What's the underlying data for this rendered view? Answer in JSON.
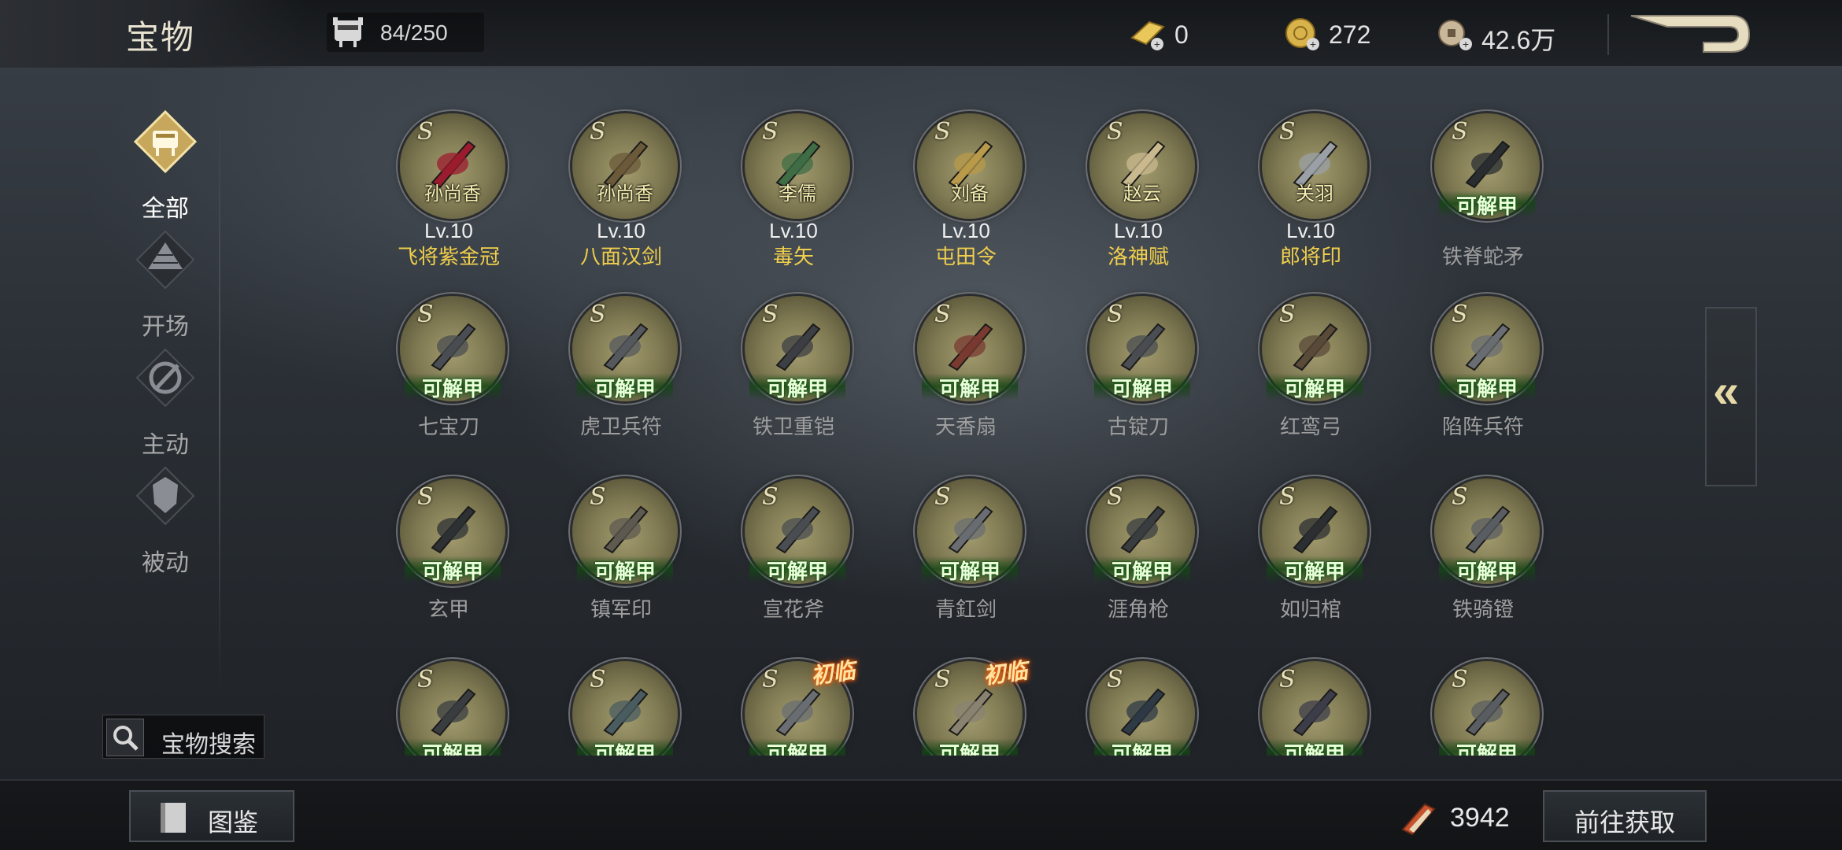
{
  "header": {
    "title": "宝物",
    "capacity": "84/250",
    "resources": [
      {
        "name": "gold-bar",
        "value": "0"
      },
      {
        "name": "gold-coin",
        "value": "272"
      },
      {
        "name": "copper-coin",
        "value": "42.6万"
      }
    ]
  },
  "nav": {
    "items": [
      {
        "label": "全部",
        "active": true,
        "icon": "ding-icon"
      },
      {
        "label": "开场",
        "active": false,
        "icon": "pyramid-icon"
      },
      {
        "label": "主动",
        "active": false,
        "icon": "slash-icon"
      },
      {
        "label": "被动",
        "active": false,
        "icon": "armor-icon"
      }
    ],
    "search_label": "宝物搜索"
  },
  "grade": "S",
  "unlock_label": "可解甲",
  "new_tag": "初临",
  "level_prefix": "Lv.",
  "treasures": [
    {
      "name": "飞将紫金冠",
      "hero": "孙尚香",
      "level": "10",
      "owned": true,
      "color": "#9b1c2e"
    },
    {
      "name": "八面汉剑",
      "hero": "孙尚香",
      "level": "10",
      "owned": true,
      "color": "#6b5a3a"
    },
    {
      "name": "毒矢",
      "hero": "李儒",
      "level": "10",
      "owned": true,
      "color": "#3f6e45"
    },
    {
      "name": "屯田令",
      "hero": "刘备",
      "level": "10",
      "owned": true,
      "color": "#b89a4a"
    },
    {
      "name": "洛神赋",
      "hero": "赵云",
      "level": "10",
      "owned": true,
      "color": "#c9b98e"
    },
    {
      "name": "郎将印",
      "hero": "关羽",
      "level": "10",
      "owned": true,
      "color": "#9aa0a6"
    },
    {
      "name": "铁脊蛇矛",
      "owned": false,
      "color": "#2a2d30"
    },
    {
      "name": "七宝刀",
      "owned": false,
      "color": "#4a4e52"
    },
    {
      "name": "虎卫兵符",
      "owned": false,
      "color": "#55595d"
    },
    {
      "name": "铁卫重铠",
      "owned": false,
      "color": "#3c3f43"
    },
    {
      "name": "天香扇",
      "owned": false,
      "color": "#7a3a30"
    },
    {
      "name": "古锭刀",
      "owned": false,
      "color": "#4a4e52"
    },
    {
      "name": "红鸾弓",
      "owned": false,
      "color": "#5a4a38"
    },
    {
      "name": "陷阵兵符",
      "owned": false,
      "color": "#6a6e72"
    },
    {
      "name": "玄甲",
      "owned": false,
      "color": "#2e3134"
    },
    {
      "name": "镇军印",
      "owned": false,
      "color": "#5e5a50"
    },
    {
      "name": "宣花斧",
      "owned": false,
      "color": "#4a4e52"
    },
    {
      "name": "青釭剑",
      "owned": false,
      "color": "#6a6e72"
    },
    {
      "name": "涯角枪",
      "owned": false,
      "color": "#3a3d40"
    },
    {
      "name": "如归棺",
      "owned": false,
      "color": "#2c2f32"
    },
    {
      "name": "铁骑镫",
      "owned": false,
      "color": "#5a5e62"
    },
    {
      "name": "",
      "owned": false,
      "color": "#3a3d40"
    },
    {
      "name": "",
      "owned": false,
      "color": "#4a5c60"
    },
    {
      "name": "",
      "owned": false,
      "color": "#6a6e72",
      "is_new": true
    },
    {
      "name": "",
      "owned": false,
      "color": "#8a8270",
      "is_new": true
    },
    {
      "name": "",
      "owned": false,
      "color": "#2e3a44"
    },
    {
      "name": "",
      "owned": false,
      "color": "#3d3d4a"
    },
    {
      "name": "",
      "owned": false,
      "color": "#5a5e62"
    }
  ],
  "footer": {
    "catalog_label": "图鉴",
    "token_count": "3942",
    "goto_label": "前往获取"
  }
}
